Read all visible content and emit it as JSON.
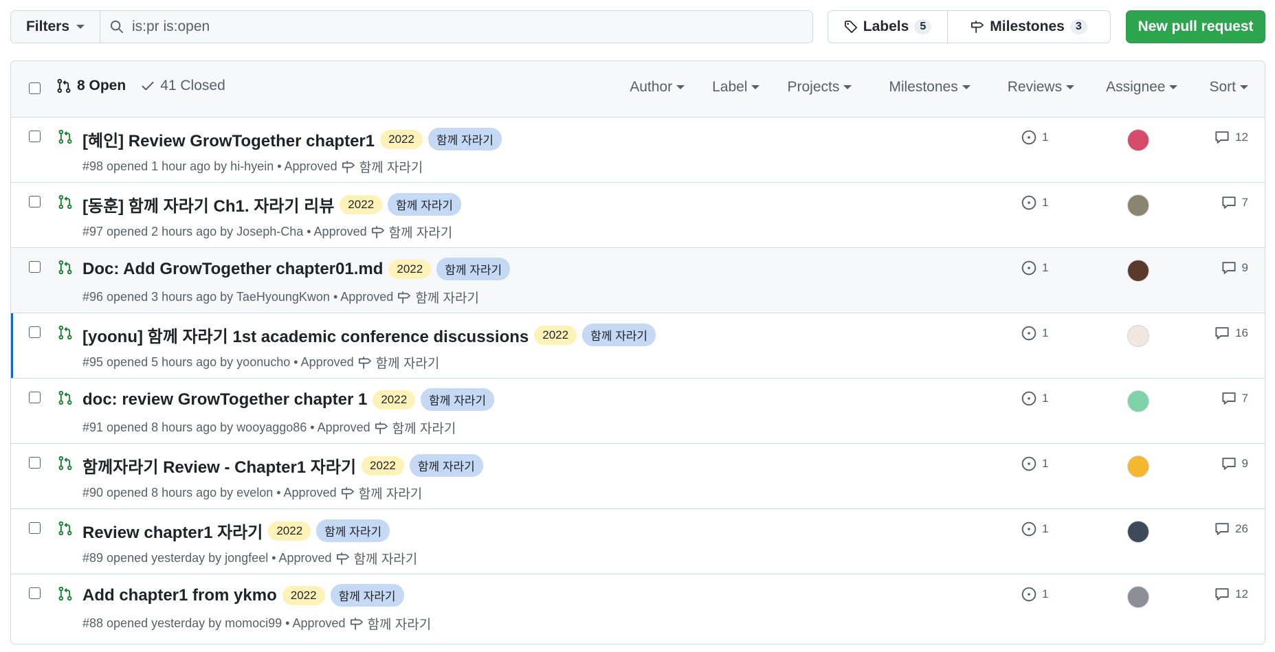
{
  "topbar": {
    "filters_label": "Filters",
    "search_value": "is:pr is:open",
    "labels_label": "Labels",
    "labels_count": "5",
    "milestones_label": "Milestones",
    "milestones_count": "3",
    "new_pr_label": "New pull request"
  },
  "header": {
    "open_label": "8 Open",
    "closed_label": "41 Closed",
    "filters": [
      "Author",
      "Label",
      "Projects",
      "Milestones",
      "Reviews",
      "Assignee",
      "Sort"
    ]
  },
  "colors": {
    "open_green": "#1a7f37",
    "primary_button": "#2da44e",
    "year_badge": "#fff2b8",
    "topic_badge": "#c5d9f5",
    "active_accent": "#0969da"
  },
  "rows": [
    {
      "title": "[혜인] Review GrowTogether chapter1",
      "badge_year": "2022",
      "badge_topic": "함께 자라기",
      "meta": "#98 opened 1 hour ago by hi-hyein • Approved",
      "milestone": "함께 자라기",
      "reviews": "1",
      "comments": "12",
      "avatar_color": "#d64a6b"
    },
    {
      "title": "[동훈] 함께 자라기 Ch1. 자라기 리뷰",
      "badge_year": "2022",
      "badge_topic": "함께 자라기",
      "meta": "#97 opened 2 hours ago by Joseph-Cha • Approved",
      "milestone": "함께 자라기",
      "reviews": "1",
      "comments": "7",
      "avatar_color": "#8a8570"
    },
    {
      "title": "Doc: Add GrowTogether chapter01.md",
      "badge_year": "2022",
      "badge_topic": "함께 자라기",
      "meta": "#96 opened 3 hours ago by TaeHyoungKwon • Approved",
      "milestone": "함께 자라기",
      "reviews": "1",
      "comments": "9",
      "avatar_color": "#5a3a2a"
    },
    {
      "title": "[yoonu] 함께 자라기 1st academic conference discussions",
      "badge_year": "2022",
      "badge_topic": "함께 자라기",
      "meta": "#95 opened 5 hours ago by yoonucho • Approved",
      "milestone": "함께 자라기",
      "reviews": "1",
      "comments": "16",
      "avatar_color": "#f1e6e0"
    },
    {
      "title": "doc: review GrowTogether chapter 1",
      "badge_year": "2022",
      "badge_topic": "함께 자라기",
      "meta": "#91 opened 8 hours ago by wooyaggo86 • Approved",
      "milestone": "함께 자라기",
      "reviews": "1",
      "comments": "7",
      "avatar_color": "#7fd1a8"
    },
    {
      "title": "함께자라기 Review - Chapter1 자라기",
      "badge_year": "2022",
      "badge_topic": "함께 자라기",
      "meta": "#90 opened 8 hours ago by evelon • Approved",
      "milestone": "함께 자라기",
      "reviews": "1",
      "comments": "9",
      "avatar_color": "#f5b82e"
    },
    {
      "title": "Review chapter1 자라기",
      "badge_year": "2022",
      "badge_topic": "함께 자라기",
      "meta": "#89 opened yesterday by jongfeel • Approved",
      "milestone": "함께 자라기",
      "reviews": "1",
      "comments": "26",
      "avatar_color": "#3c4a5a"
    },
    {
      "title": "Add chapter1 from ykmo",
      "badge_year": "2022",
      "badge_topic": "함께 자라기",
      "meta": "#88 opened yesterday by momoci99 • Approved",
      "milestone": "함께 자라기",
      "reviews": "1",
      "comments": "12",
      "avatar_color": "#8c8f96"
    }
  ]
}
